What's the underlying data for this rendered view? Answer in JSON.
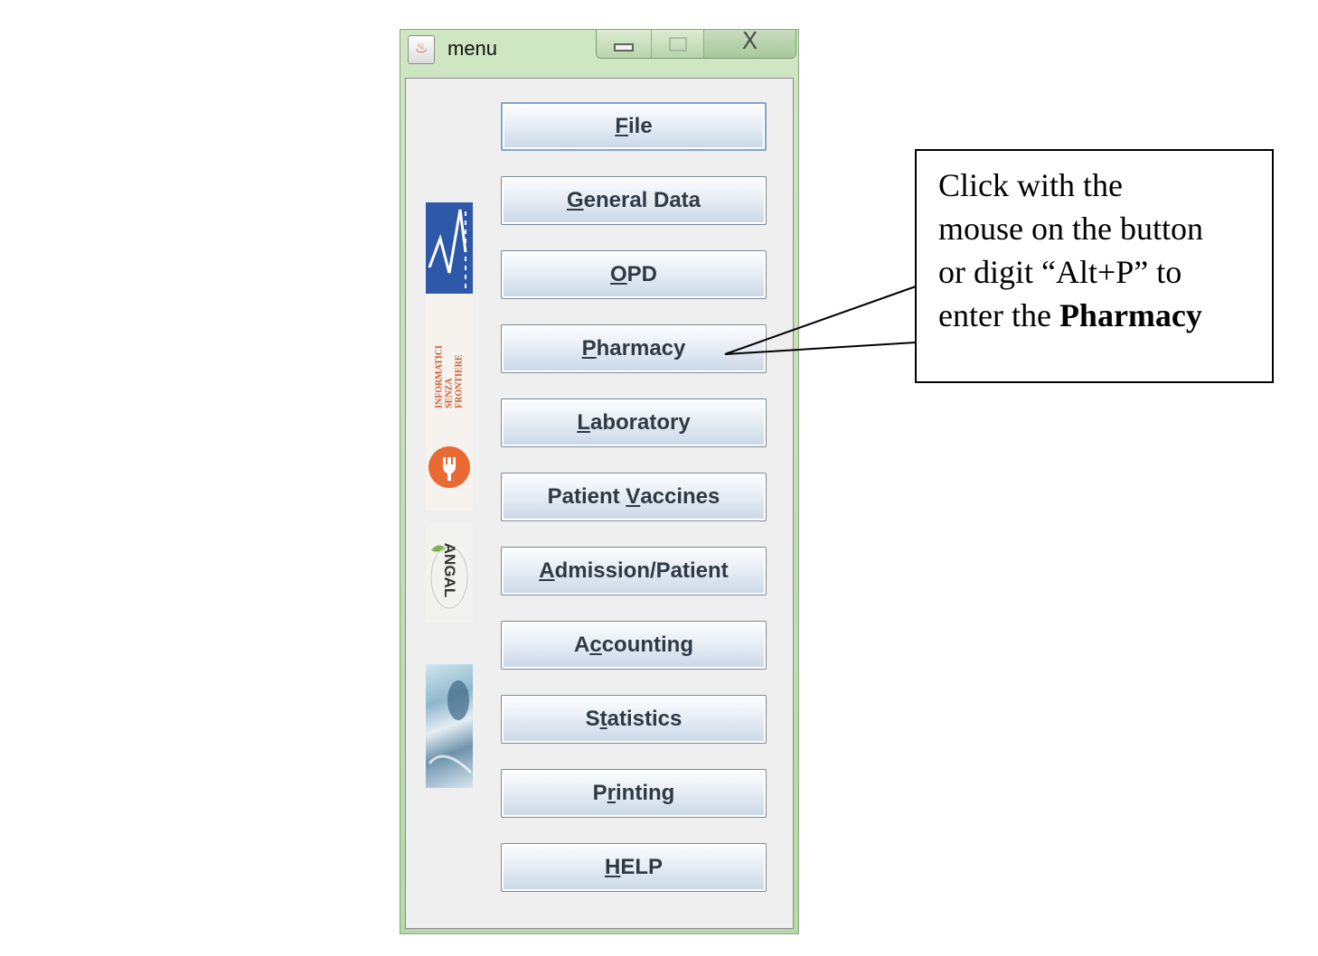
{
  "window": {
    "title": "menu",
    "icon": "java-cup-icon",
    "caption_buttons": [
      "minimize",
      "maximize",
      "close"
    ],
    "close_glyph": "X"
  },
  "logos": {
    "isf_lines": [
      "INFORMATICI",
      "SENZA",
      "FRONTIERE"
    ],
    "angal_text": "ANGAL"
  },
  "menu": {
    "buttons": [
      {
        "pre": "",
        "u": "F",
        "post": "ile"
      },
      {
        "pre": "",
        "u": "G",
        "post": "eneral Data"
      },
      {
        "pre": "",
        "u": "O",
        "post": "PD"
      },
      {
        "pre": "",
        "u": "P",
        "post": "harmacy"
      },
      {
        "pre": "",
        "u": "L",
        "post": "aboratory"
      },
      {
        "pre": "Patient ",
        "u": "V",
        "post": "accines"
      },
      {
        "pre": "",
        "u": "A",
        "post": "dmission/Patient"
      },
      {
        "pre": "A",
        "u": "c",
        "post": "counting"
      },
      {
        "pre": "S",
        "u": "t",
        "post": "atistics"
      },
      {
        "pre": "P",
        "u": "r",
        "post": "inting"
      },
      {
        "pre": "",
        "u": "H",
        "post": "ELP"
      }
    ]
  },
  "callout": {
    "line1": "Click with the",
    "line2": "mouse on the button",
    "line3": "or digit “Alt+P” to",
    "line4_prefix": "enter the ",
    "line4_bold": "Pharmacy"
  }
}
